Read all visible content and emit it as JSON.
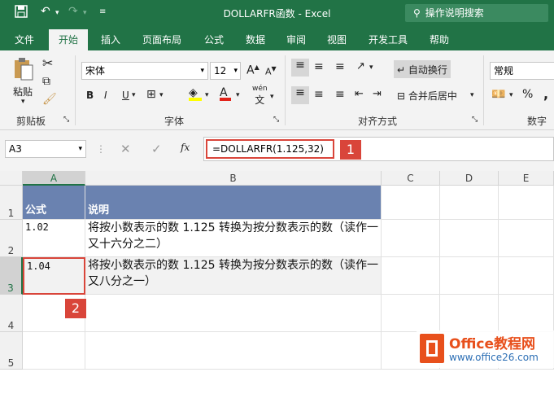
{
  "app": {
    "window_title": "DOLLARFR函数  -  Excel",
    "search_label": "操作说明搜索"
  },
  "ribbon_tabs": [
    "文件",
    "开始",
    "插入",
    "页面布局",
    "公式",
    "数据",
    "审阅",
    "视图",
    "开发工具",
    "帮助"
  ],
  "ribbon": {
    "clipboard": {
      "paste_label": "粘贴",
      "group_label": "剪贴板"
    },
    "font": {
      "font_name": "宋体",
      "font_size": "12",
      "bold": "B",
      "italic": "I",
      "underline": "U",
      "group_label": "字体",
      "font_color": "#e2231a",
      "fill_color": "#ffff00",
      "wen_label": "wén",
      "wen_char": "文"
    },
    "alignment": {
      "wrap_label": "自动换行",
      "merge_label": "合并后居中",
      "group_label": "对齐方式"
    },
    "number": {
      "format": "常规",
      "group_label": "数字",
      "percent": "%",
      "comma": ","
    }
  },
  "formula_bar": {
    "name_box": "A3",
    "fx": "fx",
    "formula": "=DOLLARFR(1.125,32)"
  },
  "sheet": {
    "columns": [
      "A",
      "B",
      "C",
      "D",
      "E"
    ],
    "rows": [
      {
        "num": "1",
        "a": "公式",
        "b": "说明"
      },
      {
        "num": "2",
        "a": "1.02",
        "b": "将按小数表示的数 1.125 转换为按分数表示的数（读作一又十六分之二）"
      },
      {
        "num": "3",
        "a": "1.04",
        "b": "将按小数表示的数 1.125 转换为按分数表示的数（读作一又八分之一）"
      },
      {
        "num": "4",
        "a": "",
        "b": ""
      },
      {
        "num": "5",
        "a": "",
        "b": ""
      }
    ],
    "header_color": "#6a82b0"
  },
  "callouts": [
    "1",
    "2"
  ],
  "watermark": {
    "brand": "Office教程网",
    "url": "www.office26.com"
  }
}
